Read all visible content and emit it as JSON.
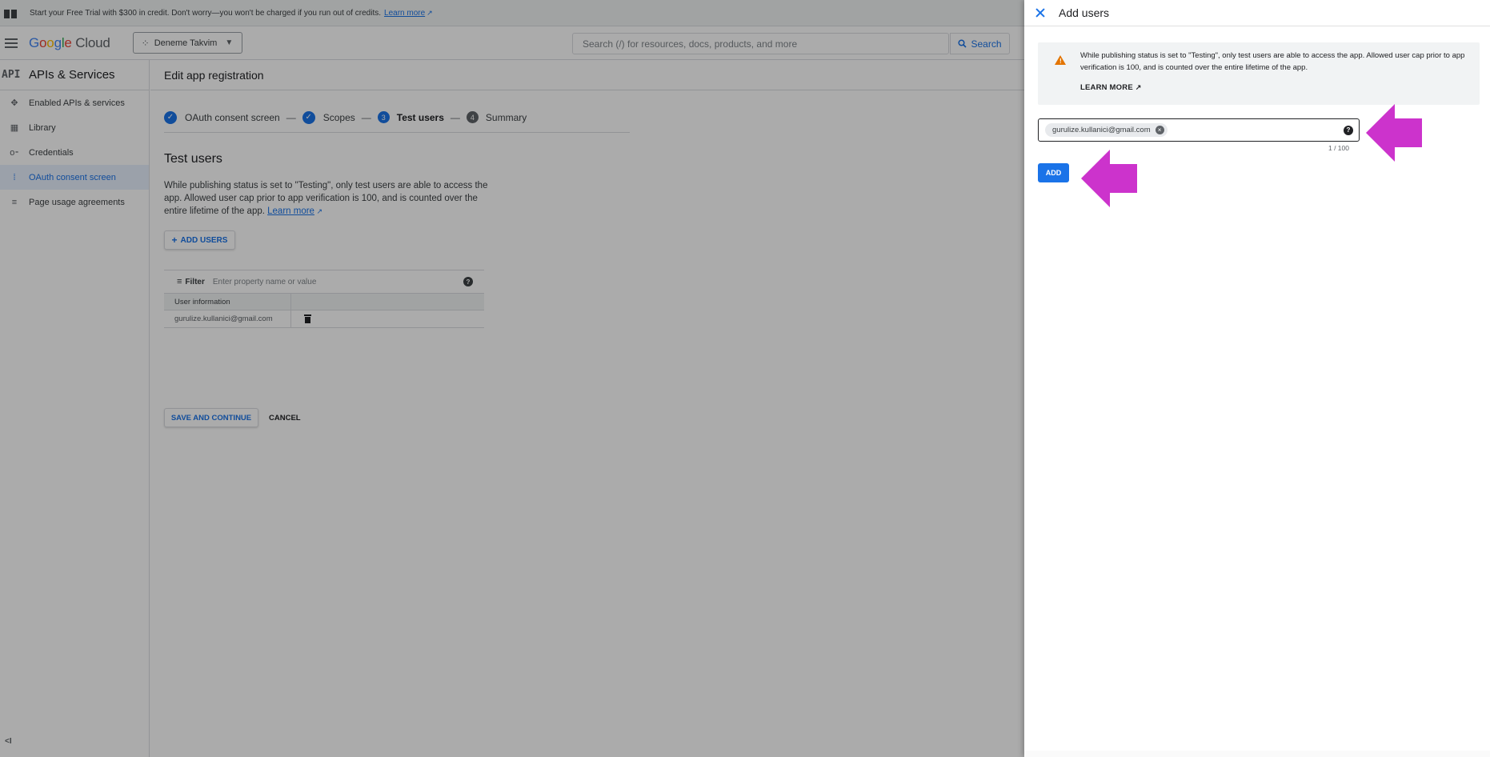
{
  "promo": {
    "text": "Start your Free Trial with $300 in credit. Don't worry—you won't be charged if you run out of credits.",
    "link": "Learn more",
    "link_icon": "external-link-icon"
  },
  "topbar": {
    "logo": "Google Cloud",
    "project": "Deneme Takvim",
    "search_placeholder": "Search (/) for resources, docs, products, and more",
    "search_button": "Search"
  },
  "sidebar": {
    "title": "APIs & Services",
    "title_icon": "API",
    "items": [
      {
        "label": "Enabled APIs & services",
        "icon": "api-icon"
      },
      {
        "label": "Library",
        "icon": "library-icon"
      },
      {
        "label": "Credentials",
        "icon": "key-icon"
      },
      {
        "label": "OAuth consent screen",
        "icon": "consent-icon",
        "active": true
      },
      {
        "label": "Page usage agreements",
        "icon": "settings-list-icon"
      }
    ],
    "collapse": "<I"
  },
  "main": {
    "title": "Edit app registration",
    "steps": [
      {
        "label": "OAuth consent screen",
        "state": "done"
      },
      {
        "label": "Scopes",
        "state": "done"
      },
      {
        "num": "3",
        "label": "Test users",
        "state": "current"
      },
      {
        "num": "4",
        "label": "Summary",
        "state": "pending"
      }
    ],
    "section_title": "Test users",
    "description": "While publishing status is set to \"Testing\", only test users are able to access the app. Allowed user cap prior to app verification is 100, and is counted over the entire lifetime of the app.",
    "learn_more": "Learn more",
    "add_users_button": "ADD USERS",
    "filter_label": "Filter",
    "filter_placeholder": "Enter property name or value",
    "table_header": "User information",
    "table_rows": [
      "gurulize.kullanici@gmail.com"
    ],
    "save_button": "SAVE AND CONTINUE",
    "cancel_button": "CANCEL"
  },
  "panel": {
    "title": "Add users",
    "warning": "While publishing status is set to \"Testing\", only test users are able to access the app. Allowed user cap prior to app verification is 100, and is counted over the entire lifetime of the app.",
    "learn_more": "LEARN MORE",
    "chip": "gurulize.kullanici@gmail.com",
    "counter": "1 / 100",
    "add_button": "ADD"
  },
  "colors": {
    "accent": "#1a73e8",
    "arrow": "#cc33cc",
    "warning": "#e37400"
  }
}
